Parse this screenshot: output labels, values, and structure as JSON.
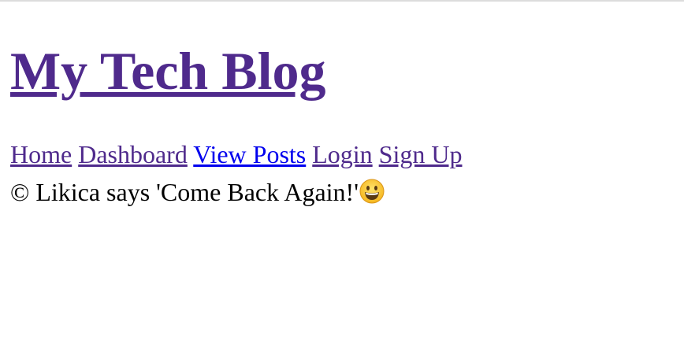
{
  "header": {
    "title": "My Tech Blog"
  },
  "nav": {
    "items": [
      {
        "label": "Home",
        "visited": true
      },
      {
        "label": "Dashboard",
        "visited": true
      },
      {
        "label": "View Posts",
        "visited": false
      },
      {
        "label": "Login",
        "visited": true
      },
      {
        "label": "Sign Up",
        "visited": true
      }
    ]
  },
  "footer": {
    "text": "© Likica says 'Come Back Again!'",
    "emoji_icon": "grinning-face-icon"
  },
  "colors": {
    "visited_link": "#4f2a8c",
    "unvisited_link": "#0000ee",
    "text": "#000000",
    "background": "#ffffff"
  }
}
